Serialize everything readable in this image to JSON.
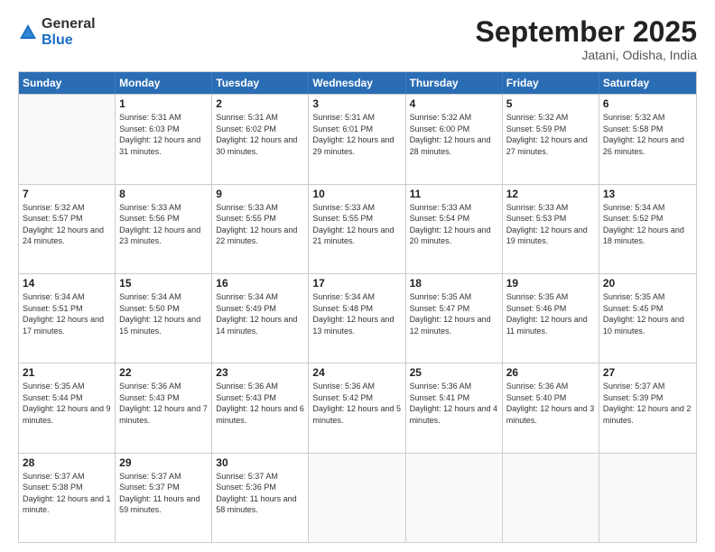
{
  "logo": {
    "general": "General",
    "blue": "Blue"
  },
  "title": "September 2025",
  "location": "Jatani, Odisha, India",
  "header_days": [
    "Sunday",
    "Monday",
    "Tuesday",
    "Wednesday",
    "Thursday",
    "Friday",
    "Saturday"
  ],
  "weeks": [
    [
      {
        "day": "",
        "empty": true
      },
      {
        "day": "1",
        "sunrise": "5:31 AM",
        "sunset": "6:03 PM",
        "daylight": "12 hours and 31 minutes."
      },
      {
        "day": "2",
        "sunrise": "5:31 AM",
        "sunset": "6:02 PM",
        "daylight": "12 hours and 30 minutes."
      },
      {
        "day": "3",
        "sunrise": "5:31 AM",
        "sunset": "6:01 PM",
        "daylight": "12 hours and 29 minutes."
      },
      {
        "day": "4",
        "sunrise": "5:32 AM",
        "sunset": "6:00 PM",
        "daylight": "12 hours and 28 minutes."
      },
      {
        "day": "5",
        "sunrise": "5:32 AM",
        "sunset": "5:59 PM",
        "daylight": "12 hours and 27 minutes."
      },
      {
        "day": "6",
        "sunrise": "5:32 AM",
        "sunset": "5:58 PM",
        "daylight": "12 hours and 26 minutes."
      }
    ],
    [
      {
        "day": "7",
        "sunrise": "5:32 AM",
        "sunset": "5:57 PM",
        "daylight": "12 hours and 24 minutes."
      },
      {
        "day": "8",
        "sunrise": "5:33 AM",
        "sunset": "5:56 PM",
        "daylight": "12 hours and 23 minutes."
      },
      {
        "day": "9",
        "sunrise": "5:33 AM",
        "sunset": "5:55 PM",
        "daylight": "12 hours and 22 minutes."
      },
      {
        "day": "10",
        "sunrise": "5:33 AM",
        "sunset": "5:55 PM",
        "daylight": "12 hours and 21 minutes."
      },
      {
        "day": "11",
        "sunrise": "5:33 AM",
        "sunset": "5:54 PM",
        "daylight": "12 hours and 20 minutes."
      },
      {
        "day": "12",
        "sunrise": "5:33 AM",
        "sunset": "5:53 PM",
        "daylight": "12 hours and 19 minutes."
      },
      {
        "day": "13",
        "sunrise": "5:34 AM",
        "sunset": "5:52 PM",
        "daylight": "12 hours and 18 minutes."
      }
    ],
    [
      {
        "day": "14",
        "sunrise": "5:34 AM",
        "sunset": "5:51 PM",
        "daylight": "12 hours and 17 minutes."
      },
      {
        "day": "15",
        "sunrise": "5:34 AM",
        "sunset": "5:50 PM",
        "daylight": "12 hours and 15 minutes."
      },
      {
        "day": "16",
        "sunrise": "5:34 AM",
        "sunset": "5:49 PM",
        "daylight": "12 hours and 14 minutes."
      },
      {
        "day": "17",
        "sunrise": "5:34 AM",
        "sunset": "5:48 PM",
        "daylight": "12 hours and 13 minutes."
      },
      {
        "day": "18",
        "sunrise": "5:35 AM",
        "sunset": "5:47 PM",
        "daylight": "12 hours and 12 minutes."
      },
      {
        "day": "19",
        "sunrise": "5:35 AM",
        "sunset": "5:46 PM",
        "daylight": "12 hours and 11 minutes."
      },
      {
        "day": "20",
        "sunrise": "5:35 AM",
        "sunset": "5:45 PM",
        "daylight": "12 hours and 10 minutes."
      }
    ],
    [
      {
        "day": "21",
        "sunrise": "5:35 AM",
        "sunset": "5:44 PM",
        "daylight": "12 hours and 9 minutes."
      },
      {
        "day": "22",
        "sunrise": "5:36 AM",
        "sunset": "5:43 PM",
        "daylight": "12 hours and 7 minutes."
      },
      {
        "day": "23",
        "sunrise": "5:36 AM",
        "sunset": "5:43 PM",
        "daylight": "12 hours and 6 minutes."
      },
      {
        "day": "24",
        "sunrise": "5:36 AM",
        "sunset": "5:42 PM",
        "daylight": "12 hours and 5 minutes."
      },
      {
        "day": "25",
        "sunrise": "5:36 AM",
        "sunset": "5:41 PM",
        "daylight": "12 hours and 4 minutes."
      },
      {
        "day": "26",
        "sunrise": "5:36 AM",
        "sunset": "5:40 PM",
        "daylight": "12 hours and 3 minutes."
      },
      {
        "day": "27",
        "sunrise": "5:37 AM",
        "sunset": "5:39 PM",
        "daylight": "12 hours and 2 minutes."
      }
    ],
    [
      {
        "day": "28",
        "sunrise": "5:37 AM",
        "sunset": "5:38 PM",
        "daylight": "12 hours and 1 minute."
      },
      {
        "day": "29",
        "sunrise": "5:37 AM",
        "sunset": "5:37 PM",
        "daylight": "11 hours and 59 minutes."
      },
      {
        "day": "30",
        "sunrise": "5:37 AM",
        "sunset": "5:36 PM",
        "daylight": "11 hours and 58 minutes."
      },
      {
        "day": "",
        "empty": true
      },
      {
        "day": "",
        "empty": true
      },
      {
        "day": "",
        "empty": true
      },
      {
        "day": "",
        "empty": true
      }
    ]
  ]
}
